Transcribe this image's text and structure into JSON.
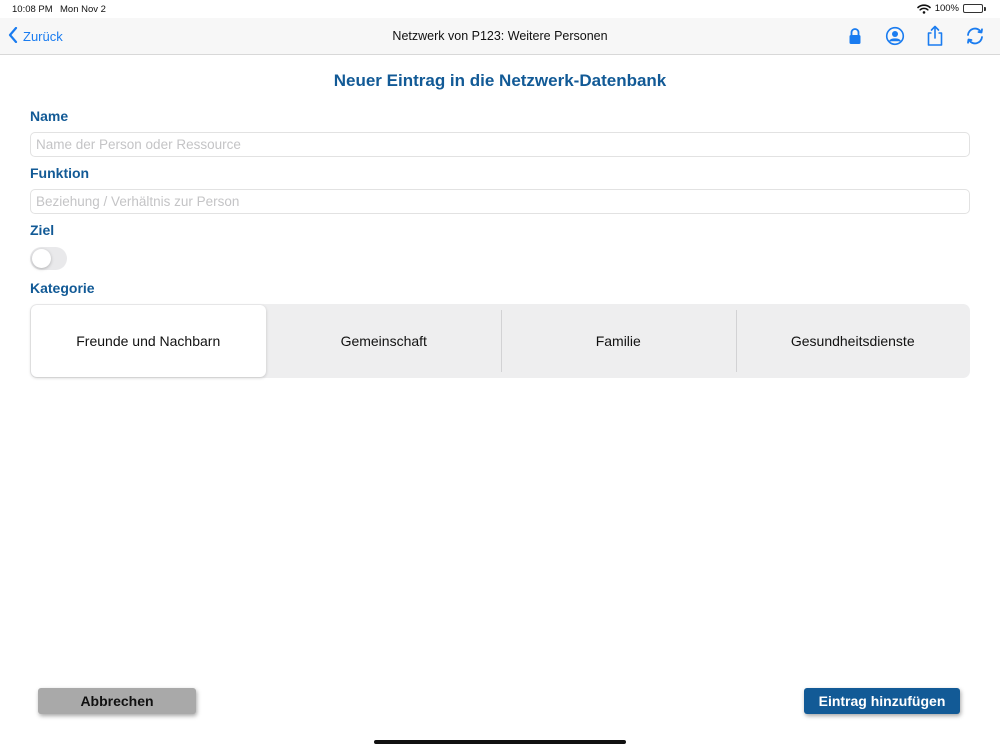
{
  "status_bar": {
    "time": "10:08 PM",
    "date": "Mon Nov 2",
    "battery_percent": "100%",
    "battery_level": 1.0
  },
  "nav": {
    "back_label": "Zurück",
    "title": "Netzwerk von P123: Weitere Personen",
    "actions": [
      "lock-icon",
      "person-circle-icon",
      "share-icon",
      "refresh-icon"
    ],
    "accent_color": "#1a7cf0"
  },
  "form": {
    "title": "Neuer Eintrag in die Netzwerk-Datenbank",
    "name": {
      "label": "Name",
      "value": "",
      "placeholder": "Name der Person oder Ressource"
    },
    "funktion": {
      "label": "Funktion",
      "value": "",
      "placeholder": "Beziehung / Verhältnis zur Person"
    },
    "ziel": {
      "label": "Ziel",
      "on": false
    },
    "kategorie": {
      "label": "Kategorie",
      "selected_index": 0,
      "options": [
        "Freunde und Nachbarn",
        "Gemeinschaft",
        "Familie",
        "Gesundheitsdienste"
      ]
    },
    "label_color": "#125a96"
  },
  "footer": {
    "cancel_label": "Abbrechen",
    "add_label": "Eintrag hinzufügen"
  }
}
